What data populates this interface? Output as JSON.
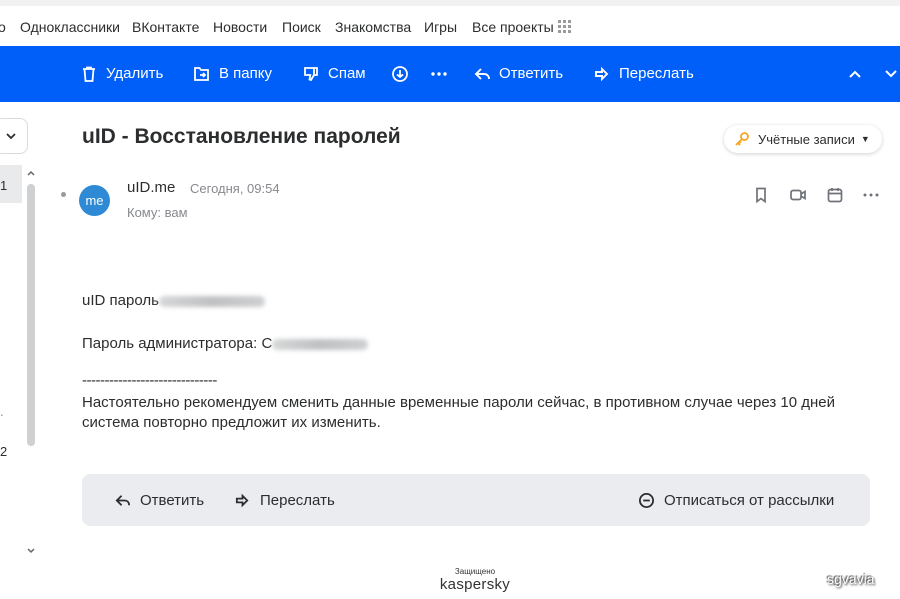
{
  "portal_nav": {
    "items": [
      "Одноклассники",
      "ВКонтакте",
      "Новости",
      "Поиск",
      "Знакомства",
      "Игры",
      "Все проекты"
    ]
  },
  "toolbar": {
    "delete": "Удалить",
    "to_folder": "В папку",
    "spam": "Спам",
    "reply": "Ответить",
    "forward": "Переслать"
  },
  "left_col": {
    "selected_count": "1",
    "count_2": "2"
  },
  "letter": {
    "subject": "uID - Восстановление паролей",
    "folder_badge": "Учётные записи",
    "avatar_initials": "me",
    "sender": "uID.me",
    "date": "Сегодня, 09:54",
    "to": "Кому: вам",
    "body": {
      "line1": "uID пароль",
      "line2": "Пароль администратора: С",
      "separator": "------------------------------",
      "line3": "Настоятельно рекомендуем сменить данные временные пароли сейчас, в противном случае через 10 дней",
      "line4": "система повторно предложит их изменить."
    }
  },
  "footer_actions": {
    "reply": "Ответить",
    "forward": "Переслать",
    "unsubscribe": "Отписаться от рассылки"
  },
  "protection": {
    "label": "Защищено",
    "brand": "kaspersky"
  },
  "watermark": "sgvavia",
  "colors": {
    "toolbar_bg": "#005ff9",
    "avatar_bg": "#2f8ad6",
    "footer_bg": "#ebecef",
    "key_icon": "#f5a623"
  }
}
